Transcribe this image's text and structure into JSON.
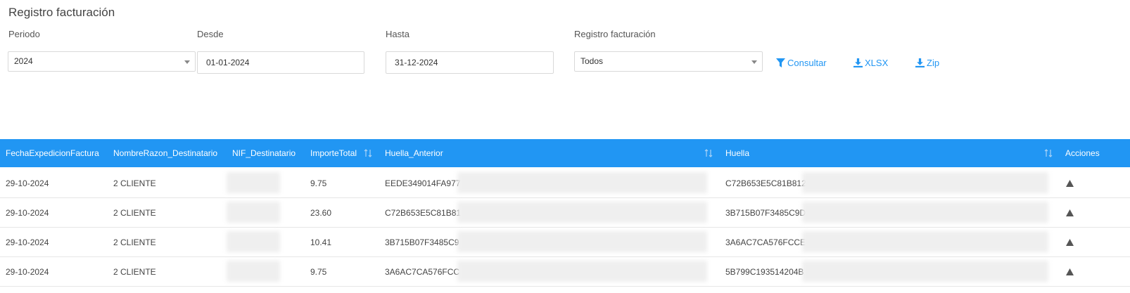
{
  "page": {
    "title": "Registro facturación"
  },
  "filters": {
    "periodo": {
      "label": "Periodo",
      "value": "2024"
    },
    "desde": {
      "label": "Desde",
      "value": "01-01-2024"
    },
    "hasta": {
      "label": "Hasta",
      "value": "31-12-2024"
    },
    "registro": {
      "label": "Registro facturación",
      "value": "Todos"
    }
  },
  "actions": {
    "consultar": "Consultar",
    "xlsx": "XLSX",
    "zip": "Zip"
  },
  "table": {
    "columns": [
      "FechaExpedicionFactura",
      "NombreRazon_Destinatario",
      "NIF_Destinatario",
      "ImporteTotal",
      "Huella_Anterior",
      "Huella",
      "Acciones"
    ],
    "rows": [
      {
        "fecha": "29-10-2024",
        "nombre": "2 CLIENTE",
        "nif": "",
        "importe": "9.75",
        "huella_anterior": "EEDE349014FA977",
        "huella": "C72B653E5C81B812"
      },
      {
        "fecha": "29-10-2024",
        "nombre": "2 CLIENTE",
        "nif": "",
        "importe": "23.60",
        "huella_anterior": "C72B653E5C81B81",
        "huella": "3B715B07F3485C9D"
      },
      {
        "fecha": "29-10-2024",
        "nombre": "2 CLIENTE",
        "nif": "",
        "importe": "10.41",
        "huella_anterior": "3B715B07F3485C9",
        "huella": "3A6AC7CA576FCCE"
      },
      {
        "fecha": "29-10-2024",
        "nombre": "2 CLIENTE",
        "nif": "",
        "importe": "9.75",
        "huella_anterior": "3A6AC7CA576FCC",
        "huella": "5B799C193514204B"
      }
    ]
  },
  "colors": {
    "accent": "#2196f3",
    "header_text": "#ffffff"
  }
}
